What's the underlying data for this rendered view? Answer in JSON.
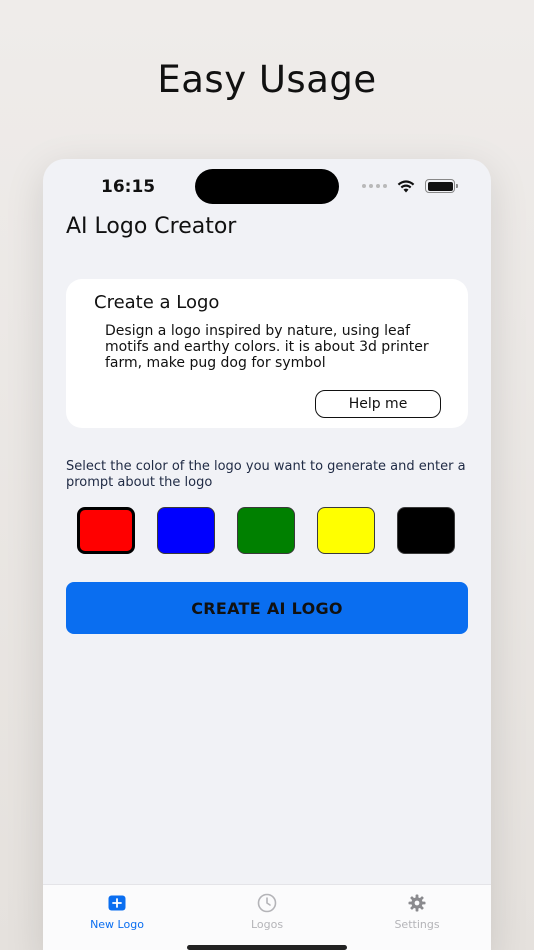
{
  "headline": "Easy Usage",
  "status_bar": {
    "time": "16:15"
  },
  "app": {
    "title": "AI Logo Creator"
  },
  "card": {
    "title": "Create a Logo",
    "prompt": "Design a logo inspired by nature, using leaf motifs and earthy colors. it is about 3d printer farm, make pug dog for symbol",
    "help_button": "Help me"
  },
  "instructions": "Select the color of the logo you want to generate and enter a prompt about the logo",
  "colors": [
    {
      "name": "red",
      "hex": "#ff0000",
      "selected": true
    },
    {
      "name": "blue",
      "hex": "#0000ff",
      "selected": false
    },
    {
      "name": "green",
      "hex": "#008000",
      "selected": false
    },
    {
      "name": "yellow",
      "hex": "#ffff00",
      "selected": false
    },
    {
      "name": "black",
      "hex": "#000000",
      "selected": false
    }
  ],
  "create_button": "CREATE AI LOGO",
  "accent_color": "#0a6ef0",
  "tabs": [
    {
      "label": "New Logo",
      "icon": "plus-square-icon",
      "active": true
    },
    {
      "label": "Logos",
      "icon": "clock-icon",
      "active": false
    },
    {
      "label": "Settings",
      "icon": "gear-icon",
      "active": false
    }
  ]
}
